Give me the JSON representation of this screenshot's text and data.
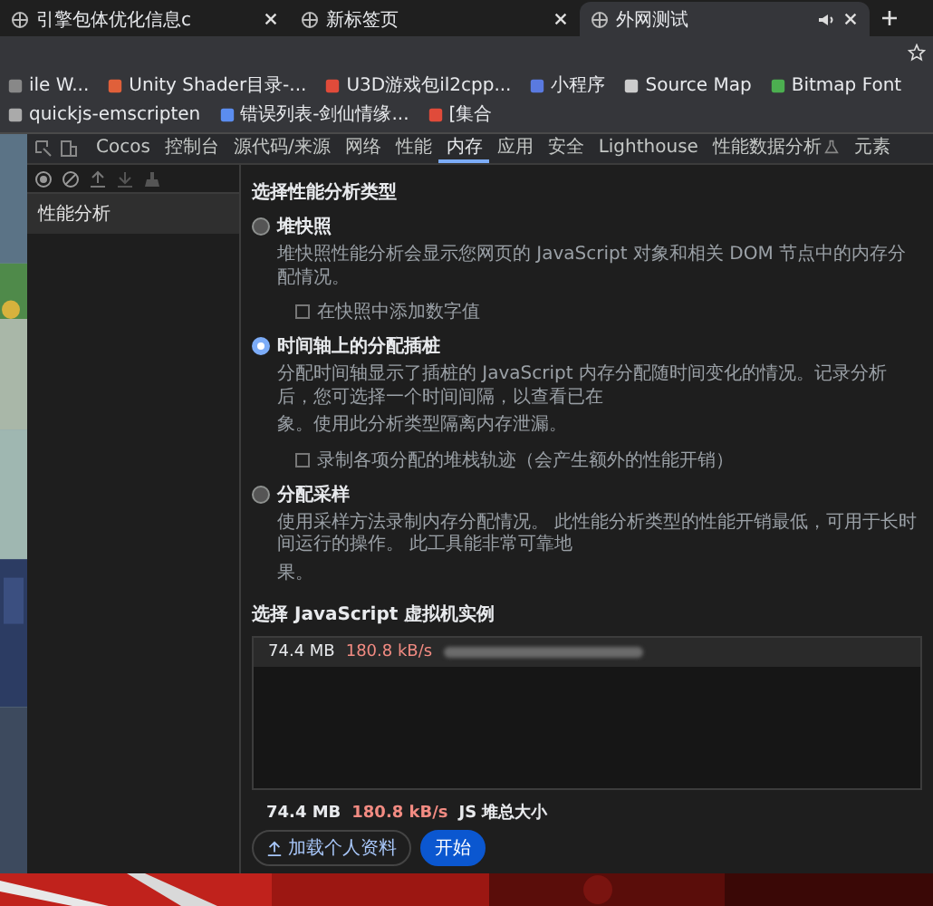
{
  "browser_tabs": [
    {
      "title": "引擎包体优化信息c",
      "selected": false,
      "audio": false
    },
    {
      "title": "新标签页",
      "selected": false,
      "audio": false
    },
    {
      "title": "外网测试",
      "selected": true,
      "audio": true
    }
  ],
  "bookmarks": [
    {
      "label": "ile W..."
    },
    {
      "label": "Unity Shader目录-..."
    },
    {
      "label": "U3D游戏包il2cpp..."
    },
    {
      "label": "小程序"
    },
    {
      "label": "Source Map"
    },
    {
      "label": "Bitmap Font"
    },
    {
      "label": "quickjs-emscripten"
    },
    {
      "label": "错误列表-剑仙情缘..."
    },
    {
      "label": "[集合"
    }
  ],
  "devtools_tabs": [
    {
      "label": "Cocos",
      "selected": false,
      "experimental": false
    },
    {
      "label": "控制台",
      "selected": false,
      "experimental": false
    },
    {
      "label": "源代码/来源",
      "selected": false,
      "experimental": false
    },
    {
      "label": "网络",
      "selected": false,
      "experimental": false
    },
    {
      "label": "性能",
      "selected": false,
      "experimental": false
    },
    {
      "label": "内存",
      "selected": true,
      "experimental": false
    },
    {
      "label": "应用",
      "selected": false,
      "experimental": false
    },
    {
      "label": "安全",
      "selected": false,
      "experimental": false
    },
    {
      "label": "Lighthouse",
      "selected": false,
      "experimental": false
    },
    {
      "label": "性能数据分析",
      "selected": false,
      "experimental": true
    },
    {
      "label": "元素",
      "selected": false,
      "experimental": false
    }
  ],
  "sidebar": {
    "items": [
      {
        "label": "性能分析",
        "selected": true
      }
    ]
  },
  "profiling": {
    "title": "选择性能分析类型",
    "options": [
      {
        "label": "堆快照",
        "selected": false,
        "description_lines": [
          "堆快照性能分析会显示您网页的 JavaScript 对象和相关 DOM 节点中的内存分配情况。"
        ],
        "checkbox": {
          "label": "在快照中添加数字值",
          "checked": false
        }
      },
      {
        "label": "时间轴上的分配插桩",
        "selected": true,
        "description_lines": [
          "分配时间轴显示了插桩的 JavaScript 内存分配随时间变化的情况。记录分析后，您可选择一个时间间隔，以查看已在",
          "象。使用此分析类型隔离内存泄漏。"
        ],
        "checkbox": {
          "label": "录制各项分配的堆栈轨迹（会产生额外的性能开销）",
          "checked": false
        }
      },
      {
        "label": "分配采样",
        "selected": false,
        "description_lines": [
          "使用采样方法录制内存分配情况。 此性能分析类型的性能开销最低，可用于长时间运行的操作。 此工具能非常可靠地",
          "果。"
        ]
      }
    ]
  },
  "vm": {
    "title": "选择 JavaScript 虚拟机实例",
    "instances": [
      {
        "memory": "74.4 MB",
        "rate": "180.8 kB/s",
        "selected": true
      }
    ]
  },
  "footer": {
    "memory": "74.4 MB",
    "rate": "180.8 kB/s",
    "label": "JS 堆总大小",
    "buttons": [
      {
        "label": "加载个人资料",
        "kind": "secondary"
      },
      {
        "label": "开始",
        "kind": "primary"
      }
    ]
  }
}
